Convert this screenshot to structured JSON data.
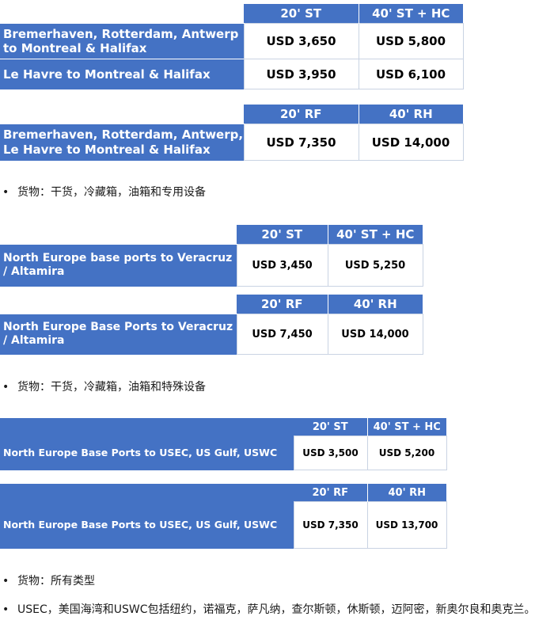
{
  "tables": [
    {
      "headers": [
        "20' ST",
        "40' ST + HC"
      ],
      "rows": [
        {
          "route": "Bremerhaven, Rotterdam, Antwerp to Montreal & Halifax",
          "prices": [
            "USD 3,650",
            "USD 5,800"
          ]
        },
        {
          "route": "Le Havre to Montreal & Halifax",
          "prices": [
            "USD 3,950",
            "USD 6,100"
          ]
        }
      ]
    },
    {
      "headers": [
        "20' RF",
        "40' RH"
      ],
      "rows": [
        {
          "route": "Bremerhaven, Rotterdam, Antwerp, Le Havre  to Montreal & Halifax",
          "prices": [
            "USD 7,350",
            "USD 14,000"
          ]
        }
      ]
    },
    {
      "headers": [
        "20' ST",
        "40' ST + HC"
      ],
      "rows": [
        {
          "route": "North Europe base ports to Veracruz / Altamira",
          "prices": [
            "USD 3,450",
            "USD 5,250"
          ]
        }
      ]
    },
    {
      "headers": [
        "20' RF",
        "40' RH"
      ],
      "rows": [
        {
          "route": "North Europe Base Ports to Veracruz / Altamira",
          "prices": [
            "USD 7,450",
            "USD 14,000"
          ]
        }
      ]
    },
    {
      "headers": [
        "20' ST",
        "40' ST + HC"
      ],
      "rows": [
        {
          "route": "North Europe Base Ports to USEC, US Gulf, USWC",
          "prices": [
            "USD 3,500",
            "USD 5,200"
          ]
        }
      ]
    },
    {
      "headers": [
        "20' RF",
        "40' RH"
      ],
      "rows": [
        {
          "route": "North Europe Base Ports to USEC, US Gulf, USWC",
          "prices": [
            "USD 7,350",
            "USD 13,700"
          ]
        }
      ]
    }
  ],
  "bullets": [
    "货物：干货，冷藏箱，油箱和专用设备",
    "货物：干货，冷藏箱，油箱和特殊设备",
    "货物：所有类型",
    "USEC，美国海湾和USWC包括纽约，诺福克，萨凡纳，查尔斯顿，休斯顿，迈阿密，新奥尔良和奥克兰。"
  ],
  "bullet_symbol": "•",
  "colors": {
    "header_bg": "#4472c4",
    "header_text": "#ffffff",
    "price_border": "#c9d3e3"
  }
}
